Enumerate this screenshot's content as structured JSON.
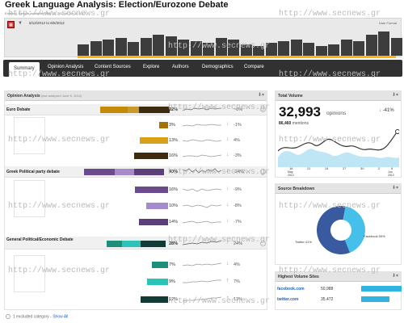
{
  "header": {
    "title": "Greek Language Analysis: Election/Eurozone Debate",
    "subtitle": "Enabled. Results available: May 12, 2012 to Jun 5, 2012"
  },
  "timeline": {
    "date_range": "5/12/2012 to 6/5/2012",
    "date_format": "Date Format"
  },
  "tabs": [
    "Summary",
    "Opinion Analysis",
    "Content Sources",
    "Explore",
    "Authors",
    "Demographics",
    "Compare"
  ],
  "watermark": "http://www.secnews.gr",
  "opinion_analysis": {
    "title": "Opinion Analysis",
    "note": "(last analyzed June 5, 2012)",
    "categories": [
      {
        "label": "Euro Debate",
        "total": {
          "pct": "32%",
          "arrow": "",
          "change": "~0%"
        },
        "rows": [
          {
            "pct": "3%",
            "arrow": "↓",
            "change": "-1%"
          },
          {
            "pct": "13%",
            "arrow": "↓",
            "change": "4%"
          },
          {
            "pct": "16%",
            "arrow": "↓",
            "change": "-3%"
          }
        ]
      },
      {
        "label": "Greek Political party debate",
        "total": {
          "pct": "40%",
          "arrow": "↓",
          "change": "-24%"
        },
        "rows": [
          {
            "pct": "16%",
            "arrow": "↓",
            "change": "-9%"
          },
          {
            "pct": "10%",
            "arrow": "↓",
            "change": "-8%"
          },
          {
            "pct": "14%",
            "arrow": "↓",
            "change": "-7%"
          }
        ]
      },
      {
        "label": "General Political/Economic Debate",
        "total": {
          "pct": "28%",
          "arrow": "↑",
          "change": "24%"
        },
        "rows": [
          {
            "pct": "7%",
            "arrow": "↓",
            "change": "4%"
          },
          {
            "pct": "9%",
            "arrow": "↑",
            "change": "7%"
          },
          {
            "pct": "12%",
            "arrow": "↑",
            "change": "13%"
          }
        ]
      }
    ],
    "footer_text": "1 excluded category -",
    "footer_link": "Show All"
  },
  "total_volume": {
    "title": "Total Volume",
    "count": "32,993",
    "unit": "opinions",
    "change": "-41%",
    "mentions_value": "86,460",
    "mentions_label": "mentions",
    "axis_ticks": [
      "18",
      "21",
      "24",
      "27",
      "30",
      "2",
      "5"
    ],
    "month_left": "May\n2012",
    "month_right": "Jun\n2012"
  },
  "source_breakdown": {
    "title": "Source Breakdown",
    "slices": [
      {
        "label": "Twitter 41%",
        "value": 41,
        "color": "#45c0ea"
      },
      {
        "label": "Facebook 59%",
        "value": 59,
        "color": "#3a5aa0"
      }
    ]
  },
  "highest_volume_sites": {
    "title": "Highest Volume Sites",
    "sites": [
      {
        "name": "facebook.com",
        "value": "50,988",
        "share": 1.0
      },
      {
        "name": "twitter.com",
        "value": "35,472",
        "share": 0.7
      }
    ]
  },
  "colors": {
    "euro": "#c38b08",
    "party": "#6b4a8e",
    "general": "#1e8e7a",
    "nav": "#313131",
    "accent": "#ffb400"
  },
  "icons": [
    "calendar-icon",
    "download-icon",
    "gear-icon",
    "arrow-down-icon",
    "arrow-up-icon",
    "circle-icon"
  ]
}
